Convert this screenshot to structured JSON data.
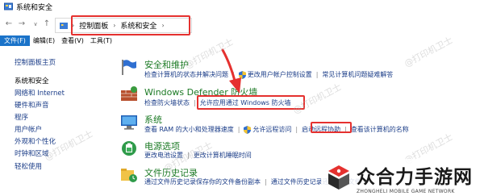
{
  "window": {
    "title": "系统和安全"
  },
  "address": {
    "crumbs": [
      "控制面板",
      "系统和安全"
    ]
  },
  "menubar": [
    "文件(F)",
    "编辑(E)",
    "查看(V)",
    "工具(T)"
  ],
  "leftnav": {
    "home": "控制面板主页",
    "items": [
      "系统和安全",
      "网络和 Internet",
      "硬件和声音",
      "程序",
      "用户帐户",
      "外观和个性化",
      "时钟和区域",
      "轻松使用"
    ]
  },
  "sections": {
    "security": {
      "title": "安全和维护",
      "link1": "检查计算机的状态并解决问题",
      "link2": "更改用户帐户控制设置",
      "link3": "常见计算机问题疑难解答"
    },
    "firewall": {
      "title": "Windows Defender 防火墙",
      "link1": "检查防火墙状态",
      "link2": "允许应用通过 Windows 防火墙"
    },
    "system": {
      "title": "系统",
      "link1": "查看 RAM 的大小和处理器速度",
      "link2": "允许远程访问",
      "link3": "启动远程协助",
      "link4": "查看该计算机的名称"
    },
    "power": {
      "title": "电源选项",
      "link1": "更改电池设置",
      "link2": "更改计算机睡眠时间"
    },
    "history": {
      "title": "文件历史记录",
      "link1": "通过文件历史记录保存你的文件备份副本",
      "link2": "通过文件历史记录还原你的文件"
    }
  },
  "watermark": "@打印机卫士",
  "brand": {
    "name": "众合力手游网",
    "sub": "ZHONGHELI MOBILE GAME NETWORK"
  }
}
